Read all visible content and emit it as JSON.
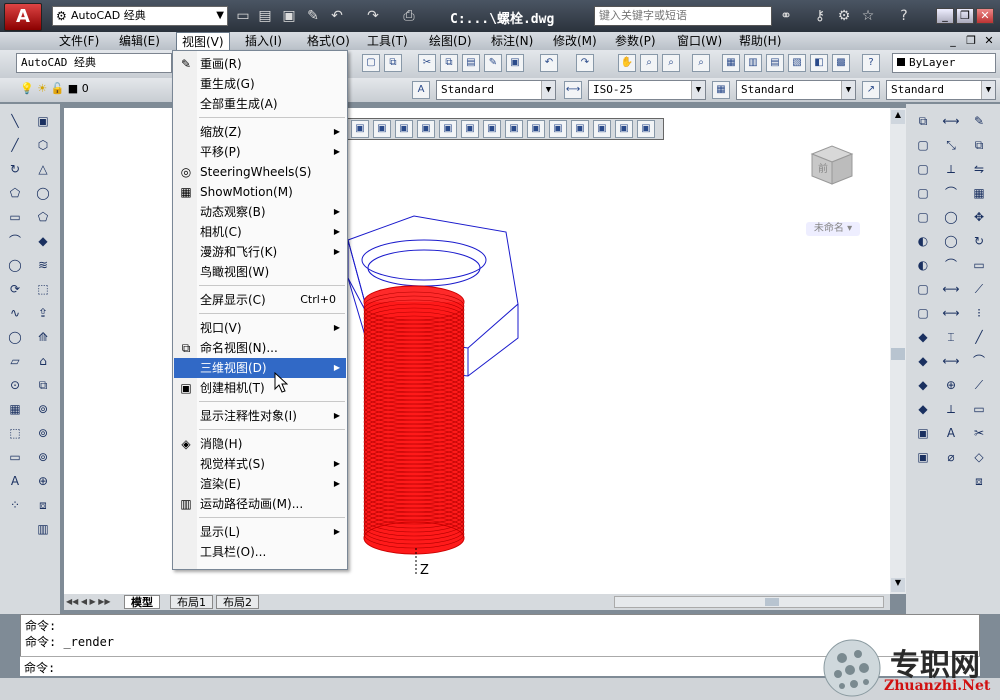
{
  "titlebar": {
    "app_logo": "A",
    "workspace": "AutoCAD 经典",
    "doc_title": "C:...\\螺栓.dwg",
    "search_placeholder": "键入关键字或短语"
  },
  "menubar": {
    "items": [
      "文件(F)",
      "编辑(E)",
      "视图(V)",
      "插入(I)",
      "格式(O)",
      "工具(T)",
      "绘图(D)",
      "标注(N)",
      "修改(M)",
      "参数(P)",
      "窗口(W)",
      "帮助(H)"
    ],
    "active_index": 2
  },
  "toolbar": {
    "workspace": "AutoCAD 经典",
    "layer_value": "0",
    "text_style": "Standard",
    "dim_style": "ISO-25",
    "table_style": "Standard",
    "mleader_style": "Standard",
    "bylayer": "ByLayer"
  },
  "view_menu": {
    "items": [
      {
        "label": "重画(R)",
        "icon": "pencil-icon",
        "glyph": "✎"
      },
      {
        "label": "重生成(G)"
      },
      {
        "label": "全部重生成(A)"
      },
      {
        "sep": true
      },
      {
        "label": "缩放(Z)",
        "submenu": true
      },
      {
        "label": "平移(P)",
        "submenu": true
      },
      {
        "label": "SteeringWheels(S)",
        "icon": "wheel-icon",
        "glyph": "◎"
      },
      {
        "label": "ShowMotion(M)",
        "icon": "film-icon",
        "glyph": "▦"
      },
      {
        "label": "动态观察(B)",
        "submenu": true
      },
      {
        "label": "相机(C)",
        "submenu": true
      },
      {
        "label": "漫游和飞行(K)",
        "submenu": true
      },
      {
        "label": "鸟瞰视图(W)"
      },
      {
        "sep": true
      },
      {
        "label": "全屏显示(C)",
        "shortcut": "Ctrl+0"
      },
      {
        "sep": true
      },
      {
        "label": "视口(V)",
        "submenu": true
      },
      {
        "label": "命名视图(N)...",
        "icon": "named-view-icon",
        "glyph": "⧉"
      },
      {
        "label": "三维视图(D)",
        "submenu": true,
        "highlighted": true
      },
      {
        "label": "创建相机(T)",
        "icon": "camera-icon",
        "glyph": "▣"
      },
      {
        "sep": true
      },
      {
        "label": "显示注释性对象(I)",
        "submenu": true
      },
      {
        "sep": true
      },
      {
        "label": "消隐(H)",
        "icon": "hide-icon",
        "glyph": "◈"
      },
      {
        "label": "视觉样式(S)",
        "submenu": true
      },
      {
        "label": "渲染(E)",
        "submenu": true
      },
      {
        "label": "运动路径动画(M)...",
        "icon": "motion-path-icon",
        "glyph": "▥"
      },
      {
        "sep": true
      },
      {
        "label": "显示(L)",
        "submenu": true
      },
      {
        "label": "工具栏(O)..."
      }
    ]
  },
  "viewcube": {
    "label": "未命名",
    "face": "前"
  },
  "tabs": [
    "模型",
    "布局1",
    "布局2"
  ],
  "command": {
    "lines": [
      "命令:",
      "命令: _render"
    ],
    "prompt": "命令:"
  },
  "watermark": {
    "cn": "专职网",
    "en": "Zhuanzhi.Net"
  },
  "colors": {
    "accent": "#3169c6",
    "bolt": "#ff0000",
    "nut": "#1a1acc"
  }
}
